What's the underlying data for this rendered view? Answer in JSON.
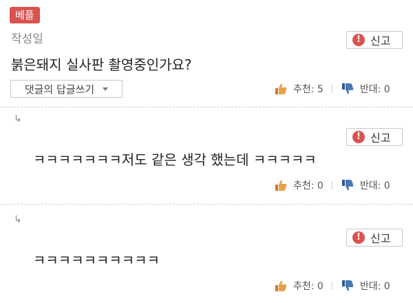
{
  "post": {
    "badge": "베플",
    "author": "작성일",
    "text": "붉은돼지 실사판 촬영중인가요?",
    "reply_button": "댓글의 답글쓰기",
    "report": "신고",
    "upvote": "추천: 5",
    "downvote": "반대: 0"
  },
  "replies": [
    {
      "arrow": "↳",
      "text": "ㅋㅋㅋㅋㅋㅋㅋ저도 같은 생각 했는데 ㅋㅋㅋㅋㅋ",
      "report": "신고",
      "upvote": "추천: 0",
      "downvote": "반대: 0"
    },
    {
      "arrow": "↳",
      "text": "ㅋㅋㅋㅋㅋㅋㅋㅋㅋㅋ",
      "report": "신고",
      "upvote": "추천: 0",
      "downvote": "반대: 0"
    }
  ],
  "colors": {
    "badge": "#d9534f",
    "report_icon": "#d9534f",
    "thumb_up": "#e8a04a",
    "thumb_down": "#4a77b4"
  },
  "icons": {
    "report": "exclamation-circle-icon",
    "upvote": "thumbs-up-icon",
    "downvote": "thumbs-down-icon",
    "reply_caret": "caret-down-icon"
  }
}
